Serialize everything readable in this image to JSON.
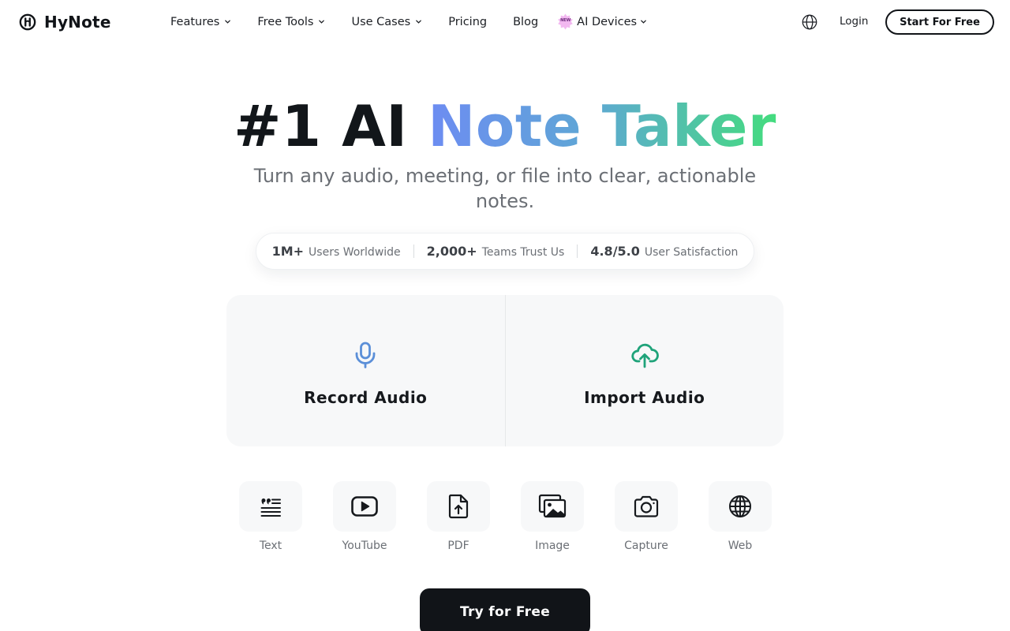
{
  "brand": {
    "name": "HyNote",
    "icon": "hynote-logo-icon"
  },
  "nav": {
    "items": [
      {
        "label": "Features",
        "has_dropdown": true
      },
      {
        "label": "Free Tools",
        "has_dropdown": true
      },
      {
        "label": "Use Cases",
        "has_dropdown": true
      },
      {
        "label": "Pricing",
        "has_dropdown": false
      },
      {
        "label": "Blog",
        "has_dropdown": false
      }
    ],
    "devices": {
      "badge": "NEW",
      "label": "AI Devices",
      "has_dropdown": true
    }
  },
  "header_actions": {
    "language_icon": "globe-icon",
    "login_label": "Login",
    "cta_label": "Start For Free"
  },
  "hero": {
    "title_dark": "#1 AI",
    "title_gradient": "Note Taker",
    "subtitle": "Turn any audio, meeting, or file into clear, actionable notes."
  },
  "stats": [
    {
      "value": "1M+",
      "label": "Users Worldwide"
    },
    {
      "value": "2,000+",
      "label": "Teams Trust Us"
    },
    {
      "value": "4.8/5.0",
      "label": "User Satisfaction"
    }
  ],
  "audio_options": {
    "record": {
      "label": "Record Audio",
      "icon": "microphone-icon"
    },
    "import": {
      "label": "Import Audio",
      "icon": "cloud-upload-icon"
    }
  },
  "sources": [
    {
      "label": "Text",
      "icon": "text-quote-icon"
    },
    {
      "label": "YouTube",
      "icon": "youtube-icon"
    },
    {
      "label": "PDF",
      "icon": "pdf-file-icon"
    },
    {
      "label": "Image",
      "icon": "image-icon"
    },
    {
      "label": "Capture",
      "icon": "camera-icon"
    },
    {
      "label": "Web",
      "icon": "web-globe-icon"
    }
  ],
  "try_button": {
    "label": "Try for Free"
  },
  "colors": {
    "primary_dark": "#111418",
    "gradient_start": "#6d8cf2",
    "gradient_end": "#44dc7e",
    "mic_blue": "#5b8fd8",
    "upload_green": "#1fa37a",
    "card_bg": "#f7f8f9"
  }
}
